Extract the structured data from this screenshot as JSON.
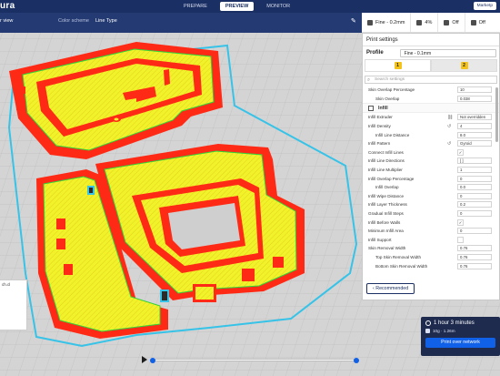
{
  "app": {
    "logo": "ura"
  },
  "stages": [
    {
      "label": "PREPARE",
      "active": false
    },
    {
      "label": "PREVIEW",
      "active": true
    },
    {
      "label": "MONITOR",
      "active": false
    }
  ],
  "marketplace_label": "Marketp",
  "subbar": {
    "view_label": "r view",
    "color_scheme_label": "Color scheme",
    "color_scheme_value": "Line Type"
  },
  "summary": {
    "profile": "Fine - 0.2mm",
    "infill": "4%",
    "support": "Off",
    "adhesion": "Off"
  },
  "panel": {
    "title": "Print settings",
    "profile_label": "Profile",
    "profile_value": "Fine - 0.1mm",
    "search_placeholder": "Search settings",
    "settings": [
      {
        "label": "Skin Overlap Percentage",
        "value": "10",
        "indent": false,
        "type": "text"
      },
      {
        "label": "Skin Overlap",
        "value": "0.038",
        "indent": true,
        "type": "text"
      },
      {
        "label": "Infill",
        "value": "",
        "indent": false,
        "type": "category"
      },
      {
        "label": "Infill Extruder",
        "value": "Not overridden",
        "indent": false,
        "type": "text",
        "action": "⛓"
      },
      {
        "label": "Infill Density",
        "value": "4",
        "indent": false,
        "type": "text",
        "action": "↺"
      },
      {
        "label": "Infill Line Distance",
        "value": "8.0",
        "indent": true,
        "type": "text"
      },
      {
        "label": "Infill Pattern",
        "value": "Gyroid",
        "indent": false,
        "type": "text",
        "action": "↺"
      },
      {
        "label": "Connect Infill Lines",
        "value": "✓",
        "indent": false,
        "type": "check"
      },
      {
        "label": "Infill Line Directions",
        "value": "[ ]",
        "indent": false,
        "type": "text"
      },
      {
        "label": "Infill Line Multiplier",
        "value": "1",
        "indent": false,
        "type": "text"
      },
      {
        "label": "Infill Overlap Percentage",
        "value": "0",
        "indent": false,
        "type": "text"
      },
      {
        "label": "Infill Overlap",
        "value": "0.0",
        "indent": true,
        "type": "text"
      },
      {
        "label": "Infill Wipe Distance",
        "value": "0",
        "indent": false,
        "type": "text"
      },
      {
        "label": "Infill Layer Thickness",
        "value": "0.2",
        "indent": false,
        "type": "text"
      },
      {
        "label": "Gradual Infill Steps",
        "value": "0",
        "indent": false,
        "type": "text"
      },
      {
        "label": "Infill Before Walls",
        "value": "✓",
        "indent": false,
        "type": "check"
      },
      {
        "label": "Minimum Infill Area",
        "value": "0",
        "indent": false,
        "type": "text"
      },
      {
        "label": "Infill Support",
        "value": "",
        "indent": false,
        "type": "check"
      },
      {
        "label": "Skin Removal Width",
        "value": "0.76",
        "indent": false,
        "type": "text"
      },
      {
        "label": "Top Skin Removal Width",
        "value": "0.76",
        "indent": true,
        "type": "text"
      },
      {
        "label": "Bottom Skin Removal Width",
        "value": "0.76",
        "indent": true,
        "type": "text"
      }
    ],
    "recommended_label": "Recommended"
  },
  "left_box_text": "ch.cl",
  "output": {
    "time": "1 hour 3 minutes",
    "material": "10g · 1.26m",
    "button": "Print over network"
  },
  "colors": {
    "wall": "#ff2a16",
    "infill": "#f1f22a",
    "skin": "#2fd33b",
    "travel": "#37c3e8",
    "bed": "#cfcfcf",
    "accent": "#1060e8",
    "topbar": "#1a2f63"
  }
}
